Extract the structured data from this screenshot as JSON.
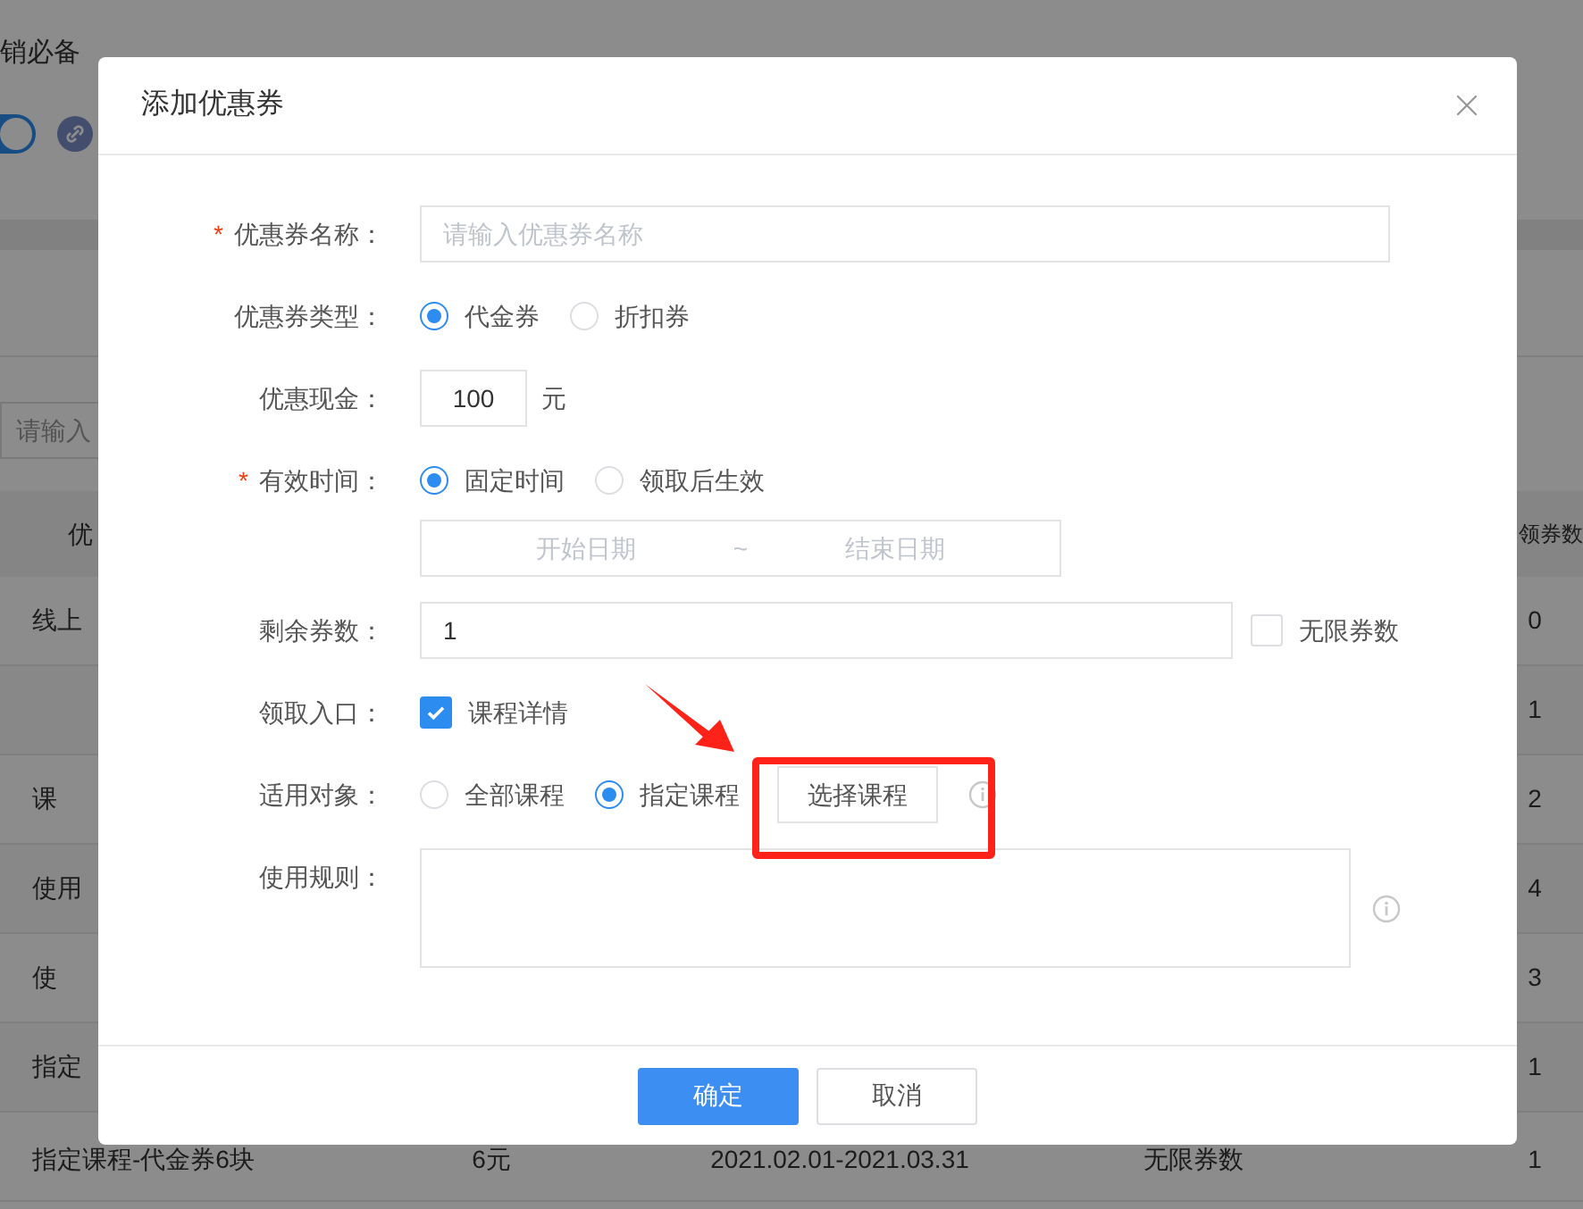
{
  "background": {
    "heading": "销必备",
    "toggle": {
      "on": true
    },
    "search": {
      "placeholder": "请输入"
    },
    "table": {
      "columns": [
        "优",
        "领券数"
      ],
      "rows": [
        {
          "name": "线上",
          "claimed": "0"
        },
        {
          "name": "",
          "claimed": "1"
        },
        {
          "name": "课",
          "claimed": "2"
        },
        {
          "name": "使用",
          "claimed": "4"
        },
        {
          "name": "使",
          "claimed": "3"
        },
        {
          "name": "指定",
          "claimed": "1"
        },
        {
          "name": "指定课程-代金券6块",
          "amount": "6元",
          "period": "2021.02.01-2021.03.31",
          "stock": "无限券数",
          "claimed": "1"
        }
      ]
    }
  },
  "modal": {
    "title": "添加优惠券",
    "fields": [
      {
        "kind": "text",
        "label": "优惠券名称：",
        "required_mark": "*",
        "placeholder": "请输入优惠券名称"
      },
      {
        "kind": "radio",
        "label": "优惠券类型：",
        "options": [
          {
            "label": "代金券",
            "selected": true
          },
          {
            "label": "折扣券",
            "selected": false
          }
        ]
      },
      {
        "kind": "amount",
        "label": "优惠现金：",
        "value": "100",
        "unit": "元"
      },
      {
        "kind": "radio",
        "label": "有效时间：",
        "required_mark": "*",
        "options": [
          {
            "label": "固定时间",
            "selected": true
          },
          {
            "label": "领取后生效",
            "selected": false
          }
        ],
        "date_range": {
          "start_placeholder": "开始日期",
          "separator": "~",
          "end_placeholder": "结束日期"
        }
      },
      {
        "kind": "count",
        "label": "剩余券数：",
        "value": "1",
        "unlimited": {
          "label": "无限券数",
          "checked": false
        }
      },
      {
        "kind": "checkbox",
        "label": "领取入口：",
        "options": [
          {
            "label": "课程详情",
            "checked": true
          }
        ]
      },
      {
        "kind": "radio",
        "label": "适用对象：",
        "options": [
          {
            "label": "全部课程",
            "selected": false
          },
          {
            "label": "指定课程",
            "selected": true
          }
        ],
        "button": "选择课程",
        "info": true
      },
      {
        "kind": "textarea",
        "label": "使用规则：",
        "info": true
      }
    ],
    "buttons": [
      {
        "label": "确定",
        "primary": true
      },
      {
        "label": "取消",
        "primary": false
      }
    ]
  }
}
